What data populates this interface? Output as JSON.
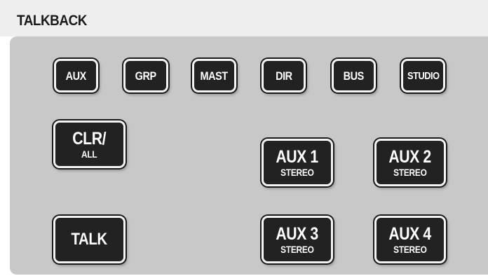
{
  "section": {
    "title": "TALKBACK"
  },
  "top_row": {
    "aux": "AUX",
    "grp": "GRP",
    "mast": "MAST",
    "dir": "DIR",
    "bus": "BUS",
    "studio": "STUDIO"
  },
  "clear_all": {
    "main": "CLR/",
    "sub": "ALL"
  },
  "talk": {
    "main": "TALK"
  },
  "aux_stereo": [
    {
      "main": "AUX 1",
      "sub": "STEREO"
    },
    {
      "main": "AUX 2",
      "sub": "STEREO"
    },
    {
      "main": "AUX 3",
      "sub": "STEREO"
    },
    {
      "main": "AUX 4",
      "sub": "STEREO"
    }
  ],
  "colors": {
    "button_face": "#222222",
    "button_bezel": "#f4f4f4",
    "panel": "#c8c8c8",
    "header": "#eeeeee"
  }
}
